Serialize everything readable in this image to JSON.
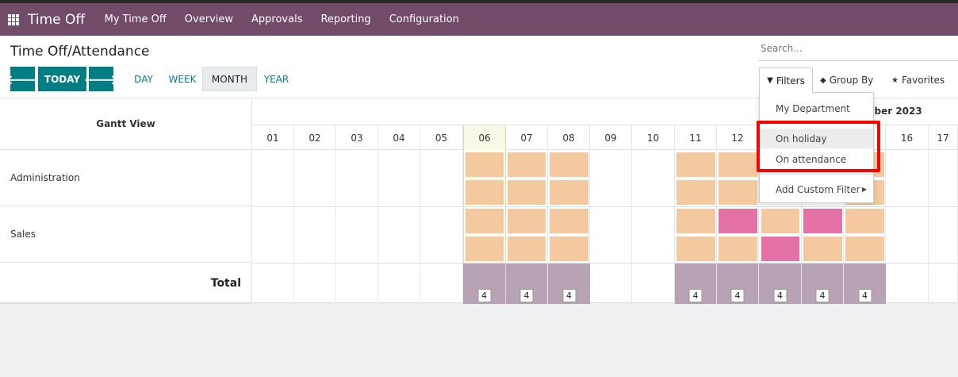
{
  "navbar": {
    "app_name": "Time Off",
    "menu": [
      "My Time Off",
      "Overview",
      "Approvals",
      "Reporting",
      "Configuration"
    ]
  },
  "page": {
    "title": "Time Off/Attendance"
  },
  "search": {
    "placeholder": "Search..."
  },
  "toolbar": {
    "prev_icon": "arrow-left-icon",
    "today_label": "TODAY",
    "next_icon": "arrow-right-icon",
    "scales": [
      "DAY",
      "WEEK",
      "MONTH",
      "YEAR"
    ],
    "active_scale": "MONTH"
  },
  "search_panel": {
    "filters_label": "Filters",
    "groupby_label": "Group By",
    "favorites_label": "Favorites"
  },
  "filters_menu": {
    "items": [
      "My Department",
      "On holiday",
      "On attendance"
    ],
    "hovered": "On holiday",
    "custom_filter_label": "Add Custom Filter"
  },
  "gantt": {
    "view_title": "Gantt View",
    "month_title": "mber 2023",
    "days": [
      "01",
      "02",
      "03",
      "04",
      "05",
      "06",
      "07",
      "08",
      "09",
      "10",
      "11",
      "12",
      "13",
      "14",
      "15",
      "16",
      "17"
    ],
    "today": "06",
    "rows": [
      "Administration",
      "Sales"
    ],
    "total_label": "Total",
    "totals": {
      "06": "4",
      "07": "4",
      "08": "4",
      "11": "4",
      "12": "4",
      "13": "4",
      "14": "4",
      "15": "4"
    }
  },
  "colors": {
    "brand": "#714b67",
    "primary": "#017e84",
    "pill_peach": "#f5c9a0",
    "pill_pink": "#e572a5",
    "total_bar": "#b7a3b3",
    "highlight": "#ff0000"
  }
}
